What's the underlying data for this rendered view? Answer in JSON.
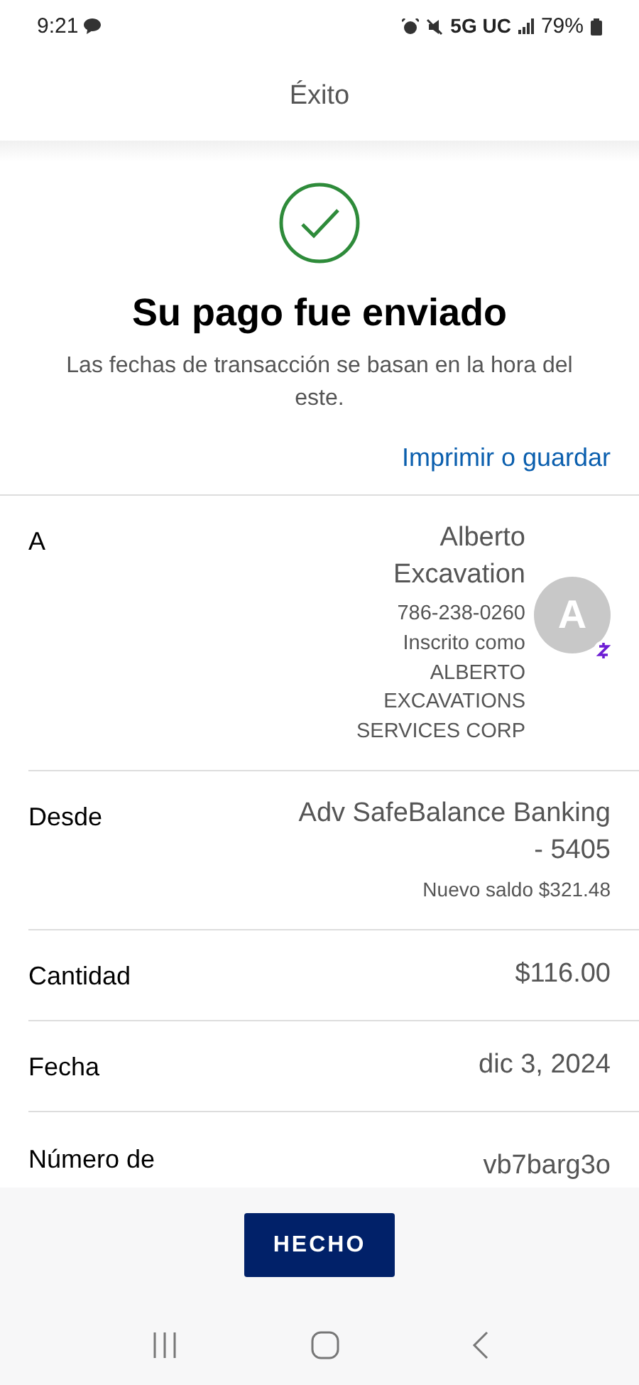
{
  "status_bar": {
    "time": "9:21",
    "network": "5G UC",
    "battery": "79%"
  },
  "header": {
    "title": "Éxito"
  },
  "confirmation": {
    "title": "Su pago fue enviado",
    "subtitle": "Las fechas de transacción se basan en la hora del este.",
    "link": "Imprimir o guardar"
  },
  "details": [
    {
      "kind": "recipient",
      "label": "A",
      "name": "Alberto Excavation",
      "phone": "786-238-0260",
      "enrolled": "Inscrito como ALBERTO EXCAVATIONS SERVICES CORP",
      "avatar": "A"
    },
    {
      "kind": "account",
      "label": "Desde",
      "value": "Adv SafeBalance Banking - 5405",
      "note": "Nuevo saldo $321.48"
    },
    {
      "kind": "plain",
      "label": "Cantidad",
      "value": "$116.00"
    },
    {
      "kind": "plain",
      "label": "Fecha",
      "value": "dic 3, 2024"
    },
    {
      "kind": "plain",
      "label": "Número de",
      "value": "vb7barg3o"
    }
  ],
  "footer": {
    "button": "HECHO"
  }
}
